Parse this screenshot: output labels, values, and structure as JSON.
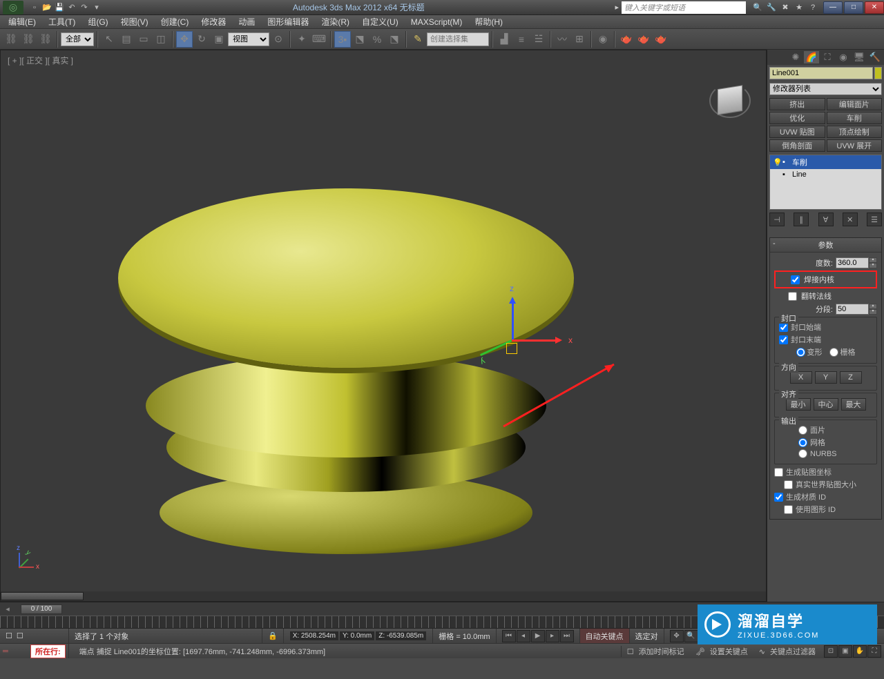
{
  "titlebar": {
    "app_title": "Autodesk 3ds Max 2012 x64   无标题",
    "search_placeholder": "键入关键字或短语"
  },
  "menus": [
    "编辑(E)",
    "工具(T)",
    "组(G)",
    "视图(V)",
    "创建(C)",
    "修改器",
    "动画",
    "图形编辑器",
    "渲染(R)",
    "自定义(U)",
    "MAXScript(M)",
    "帮助(H)"
  ],
  "toolbar": {
    "select_filter": "全部",
    "view_mode": "视图",
    "selection_set_placeholder": "创建选择集"
  },
  "viewport": {
    "label": "[ + ][ 正交 ][ 真实 ]"
  },
  "panel": {
    "object_name": "Line001",
    "modifier_list_label": "修改器列表",
    "mod_buttons": [
      "挤出",
      "编辑面片",
      "优化",
      "车削",
      "UVW 贴图",
      "顶点绘制",
      "倒角剖面",
      "UVW 展开"
    ],
    "stack": [
      {
        "icon": "💡",
        "plus": "☐",
        "label": "车削",
        "selected": true
      },
      {
        "icon": "",
        "plus": "☐",
        "label": "Line",
        "selected": false
      }
    ],
    "params_title": "参数",
    "degrees_label": "度数:",
    "degrees_value": "360.0",
    "weld_core_label": "焊接内核",
    "flip_normals_label": "翻转法线",
    "segments_label": "分段:",
    "segments_value": "50",
    "cap_group": "封口",
    "cap_start": "封口始端",
    "cap_end": "封口末端",
    "morph": "变形",
    "grid": "栅格",
    "direction_group": "方向",
    "dir_x": "X",
    "dir_y": "Y",
    "dir_z": "Z",
    "align_group": "对齐",
    "align_min": "最小",
    "align_center": "中心",
    "align_max": "最大",
    "output_group": "输出",
    "out_patch": "面片",
    "out_mesh": "网格",
    "out_nurbs": "NURBS",
    "gen_map": "生成贴图坐标",
    "real_world": "真实世界贴图大小",
    "gen_mat": "生成材质 ID",
    "use_shape": "使用图形 ID"
  },
  "timeline": {
    "pos": "0 / 100"
  },
  "status": {
    "selection": "选择了 1 个对象",
    "x": "X: 2508.254m",
    "y": "Y: 0.0mm",
    "z": "Z: -6539.085m",
    "grid": "栅格 = 10.0mm",
    "autokey": "自动关键点",
    "selset": "选定对",
    "setkey": "设置关键点",
    "keyfilter": "关键点过滤器",
    "prompt": "端点 捕捉 Line001的坐标位置:  [1697.76mm, -741.248mm, -6996.373mm]",
    "add_marker": "添加时间标记",
    "row_label": "所在行:"
  },
  "watermark": {
    "big": "溜溜自学",
    "small": "ZIXUE.3D66.COM"
  }
}
